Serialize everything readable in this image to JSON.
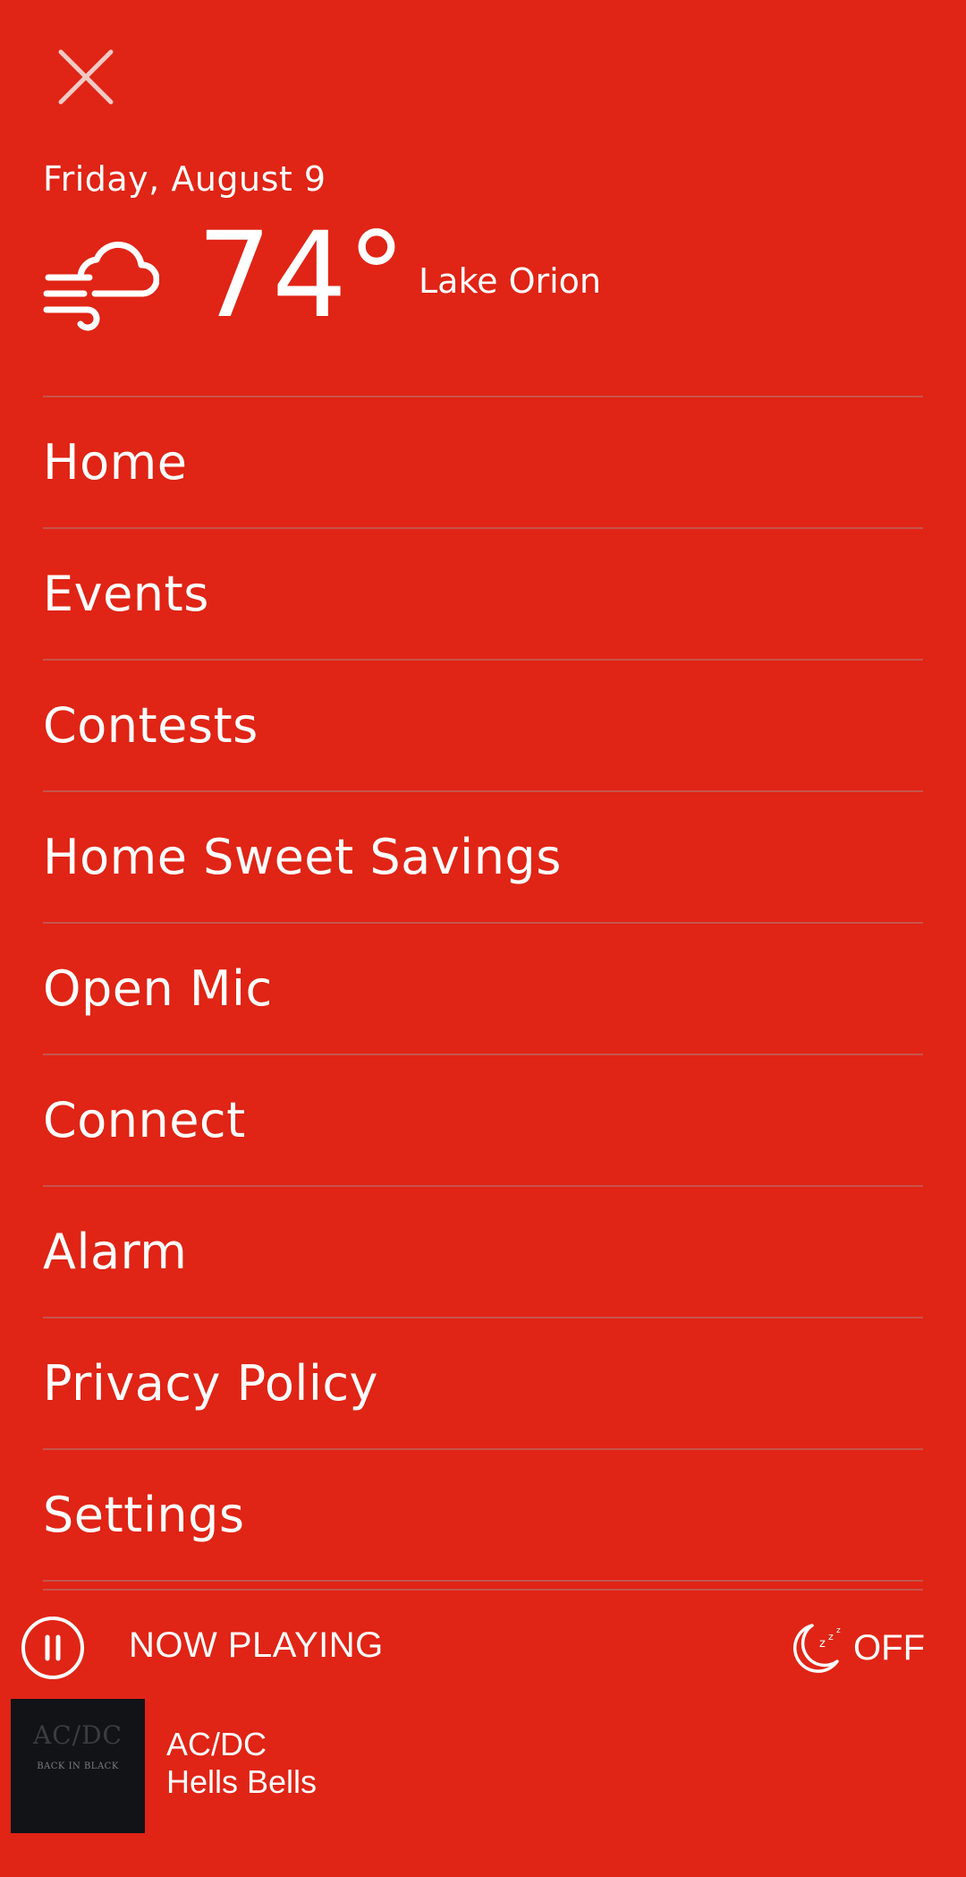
{
  "header": {
    "close_icon": "close-icon",
    "date": "Friday, August 9"
  },
  "weather": {
    "icon": "windy-cloud-icon",
    "temperature": "74°",
    "location": "Lake Orion"
  },
  "menu": {
    "items": [
      {
        "label": "Home"
      },
      {
        "label": "Events"
      },
      {
        "label": "Contests"
      },
      {
        "label": "Home Sweet Savings"
      },
      {
        "label": "Open Mic"
      },
      {
        "label": "Connect"
      },
      {
        "label": "Alarm"
      },
      {
        "label": "Privacy Policy"
      },
      {
        "label": "Settings"
      }
    ]
  },
  "player": {
    "pause_icon": "pause-icon",
    "now_playing_label": "NOW PLAYING",
    "sleep_icon": "sleep-timer-moon-icon",
    "sleep_label": "OFF",
    "artist": "AC/DC",
    "song": "Hells Bells",
    "album_logo": "AC/DC",
    "album_subtitle": "BACK IN BLACK"
  },
  "colors": {
    "background": "#e02415",
    "text": "#ffffff",
    "divider": "#c6544d",
    "album_bg": "#111316"
  }
}
